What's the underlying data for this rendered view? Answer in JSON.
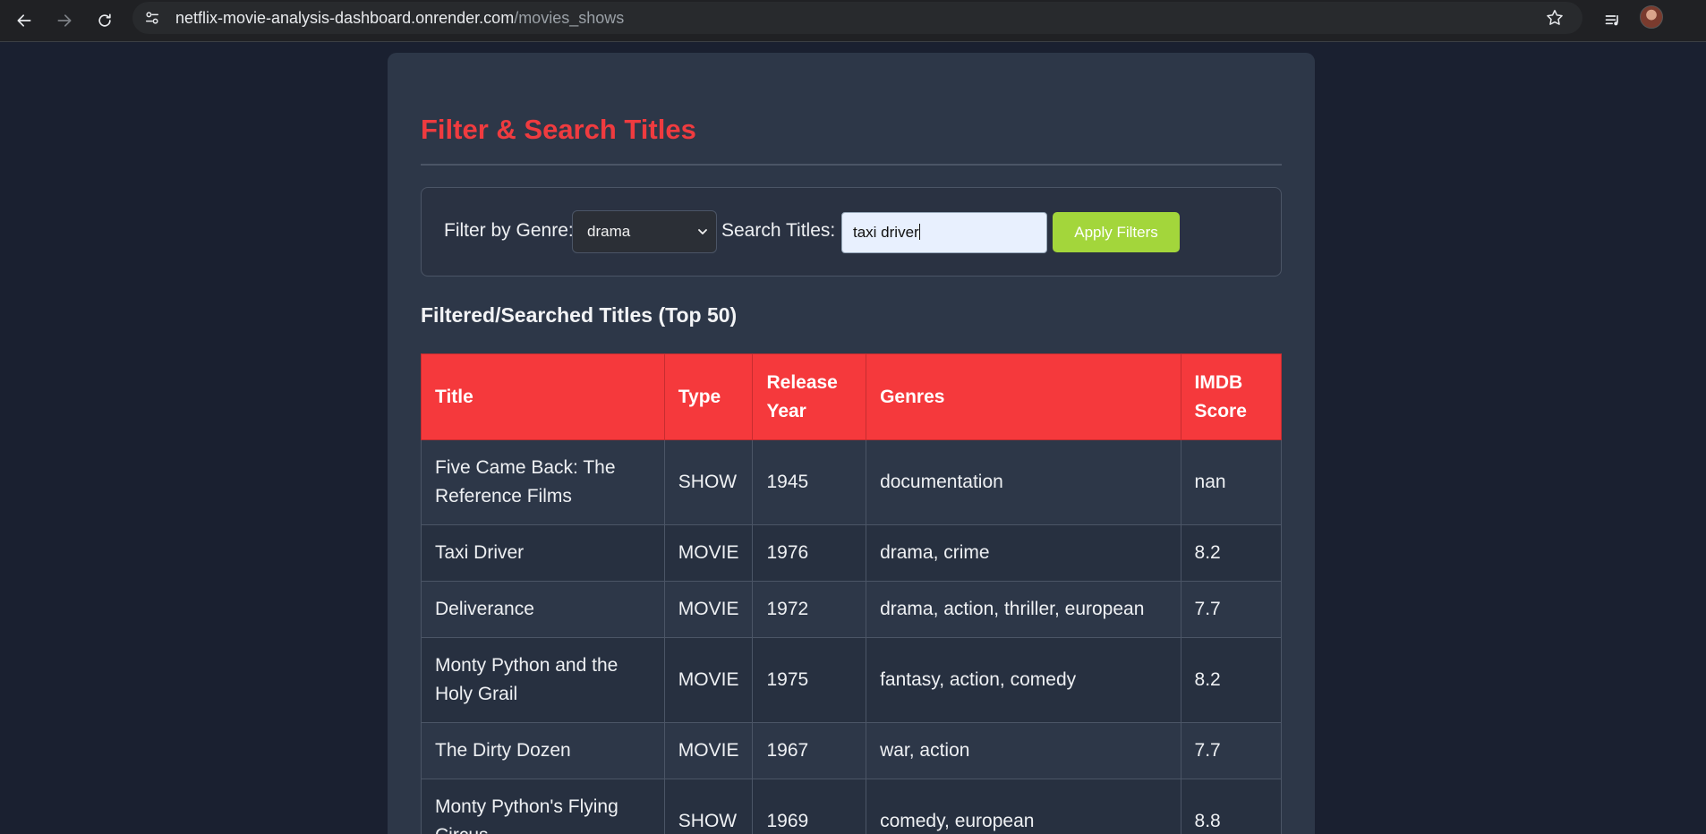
{
  "browser": {
    "url_host": "netflix-movie-analysis-dashboard.onrender.com",
    "url_path": "/movies_shows",
    "icons": [
      "back-arrow-icon",
      "forward-arrow-icon",
      "reload-icon",
      "site-settings-icon",
      "bookmark-star-icon",
      "media-queue-icon",
      "profile-avatar"
    ]
  },
  "page": {
    "title": "Filter & Search Titles"
  },
  "filters": {
    "genre_label": "Filter by Genre:",
    "genre_selected": "drama",
    "search_label": "Search Titles:",
    "search_value": "taxi driver",
    "apply_label": "Apply Filters"
  },
  "results": {
    "heading": "Filtered/Searched Titles (Top 50)",
    "columns": [
      "Title",
      "Type",
      "Release Year",
      "Genres",
      "IMDB Score"
    ],
    "rows": [
      {
        "title": "Five Came Back: The Reference Films",
        "type": "SHOW",
        "year": "1945",
        "genres": "documentation",
        "score": "nan"
      },
      {
        "title": "Taxi Driver",
        "type": "MOVIE",
        "year": "1976",
        "genres": "drama, crime",
        "score": "8.2"
      },
      {
        "title": "Deliverance",
        "type": "MOVIE",
        "year": "1972",
        "genres": "drama, action, thriller, european",
        "score": "7.7"
      },
      {
        "title": "Monty Python and the Holy Grail",
        "type": "MOVIE",
        "year": "1975",
        "genres": "fantasy, action, comedy",
        "score": "8.2"
      },
      {
        "title": "The Dirty Dozen",
        "type": "MOVIE",
        "year": "1967",
        "genres": "war, action",
        "score": "7.7"
      },
      {
        "title": "Monty Python's Flying Circus",
        "type": "SHOW",
        "year": "1969",
        "genres": "comedy, european",
        "score": "8.8"
      }
    ]
  },
  "colors": {
    "accent_red": "#ef3b3f",
    "header_red": "#f5393c",
    "apply_green": "#a3d63b",
    "card_bg": "#2d3748",
    "page_bg": "#1a2030"
  }
}
